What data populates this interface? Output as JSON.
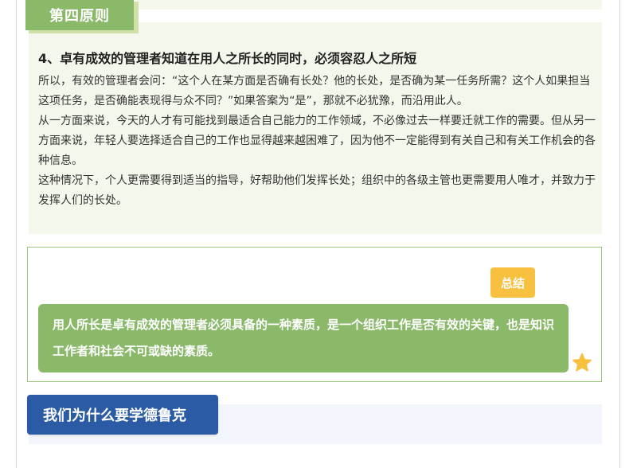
{
  "principle": {
    "tag": "第四原则",
    "heading": "4、卓有成效的管理者知道在用人之所长的同时，必须容忍人之所短",
    "paragraphs": [
      "所以，有效的管理者会问：“这个人在某方面是否确有长处？他的长处，是否确为某一任务所需？这个人如果担当这项任务，是否确能表现得与众不同？”如果答案为“是”，那就不必犹豫，而沿用此人。",
      "从一方面来说，今天的人才有可能找到最适合自己能力的工作领域，不必像过去一样要迁就工作的需要。但从另一方面来说，年轻人要选择适合自己的工作也显得越来越困难了，因为他不一定能得到有关自己和有关工作机会的各种信息。",
      "这种情况下，个人更需要得到适当的指导，好帮助他们发挥长处；组织中的各级主管也更需要用人唯才，并致力于发挥人们的长处。"
    ]
  },
  "summary": {
    "badge": "总结",
    "text": "用人所长是卓有成效的管理者必须具备的一种素质，是一个组织工作是否有效的关键，也是知识工作者和社会不可或缺的素质。"
  },
  "next_section": {
    "title": "我们为什么要学德鲁克"
  },
  "colors": {
    "green_accent": "#8ab96a",
    "card_bg": "#f4f8ec",
    "badge_yellow": "#f7c03e",
    "blue_accent": "#2a5ba4"
  }
}
